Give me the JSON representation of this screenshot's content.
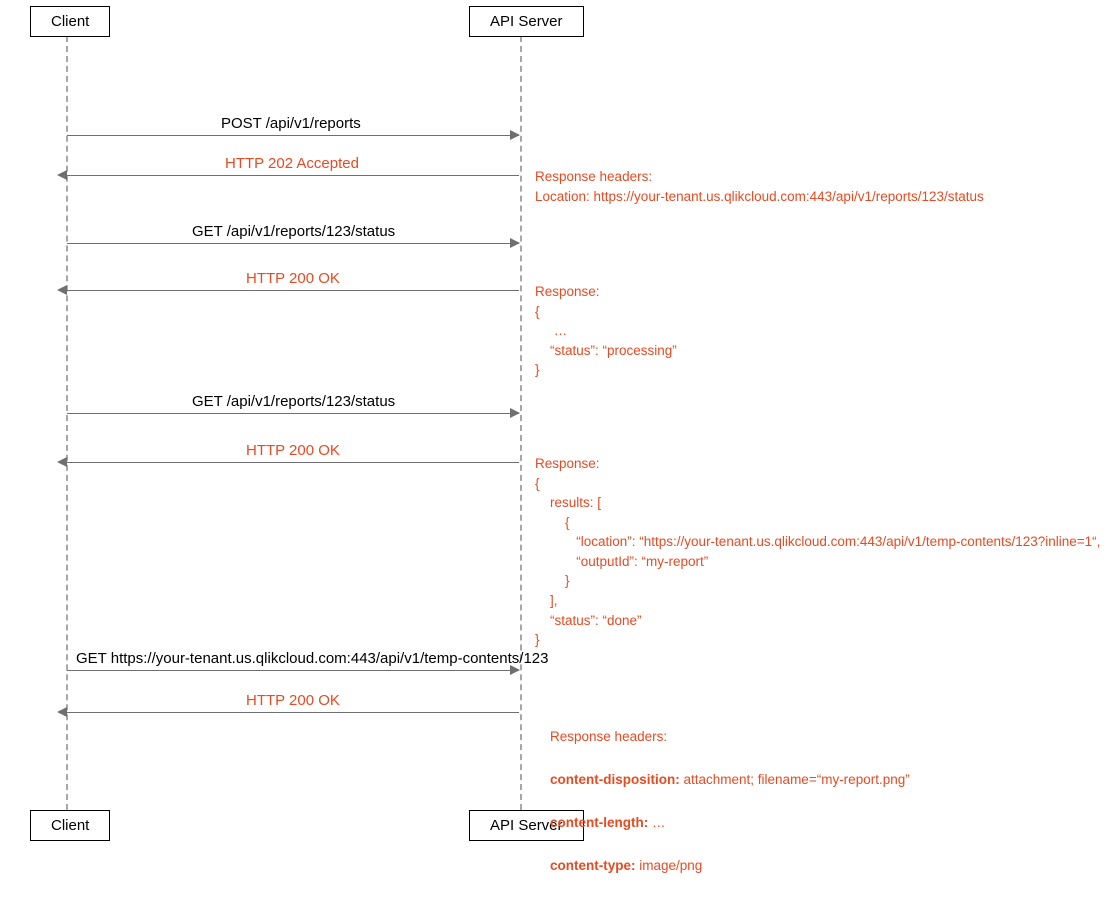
{
  "actors": {
    "client": "Client",
    "server": "API Server"
  },
  "messages": {
    "m1_req": "POST /api/v1/reports",
    "m1_resp": "HTTP 202 Accepted",
    "m2_req": "GET  /api/v1/reports/123/status",
    "m2_resp": "HTTP 200 OK",
    "m3_req": "GET  /api/v1/reports/123/status",
    "m3_resp": "HTTP 200 OK",
    "m4_req": "GET https://your-tenant.us.qlikcloud.com:443/api/v1/temp-contents/123",
    "m4_resp": "HTTP 200 OK"
  },
  "notes": {
    "n1": "Response headers:\nLocation: https://your-tenant.us.qlikcloud.com:443/api/v1/reports/123/status",
    "n2": "Response:\n{\n     …\n    “status”: “processing”\n}",
    "n3": "Response:\n{\n    results: [\n        {\n           “location”: “https://your-tenant.us.qlikcloud.com:443/api/v1/temp-contents/123?inline=1“,\n           “outputId”: “my-report”\n        }\n    ],\n    “status”: “done”\n}",
    "n4_l1a": "Response headers:",
    "n4_l2a": "content-disposition: ",
    "n4_l2b": "attachment; filename=“my-report.png”",
    "n4_l3a": "content-length: ",
    "n4_l3b": "…",
    "n4_l4a": "content-type: ",
    "n4_l4b": "image/png"
  },
  "colors": {
    "highlight": "#e84a22",
    "line": "#6f6f6f",
    "lifeline": "#a7a7a7"
  },
  "geometry": {
    "clientX": 66,
    "serverX": 520,
    "topBoxesY": 6,
    "bottomBoxesY": 810,
    "lifelineTop": 36,
    "lifelineBottom": 810
  }
}
